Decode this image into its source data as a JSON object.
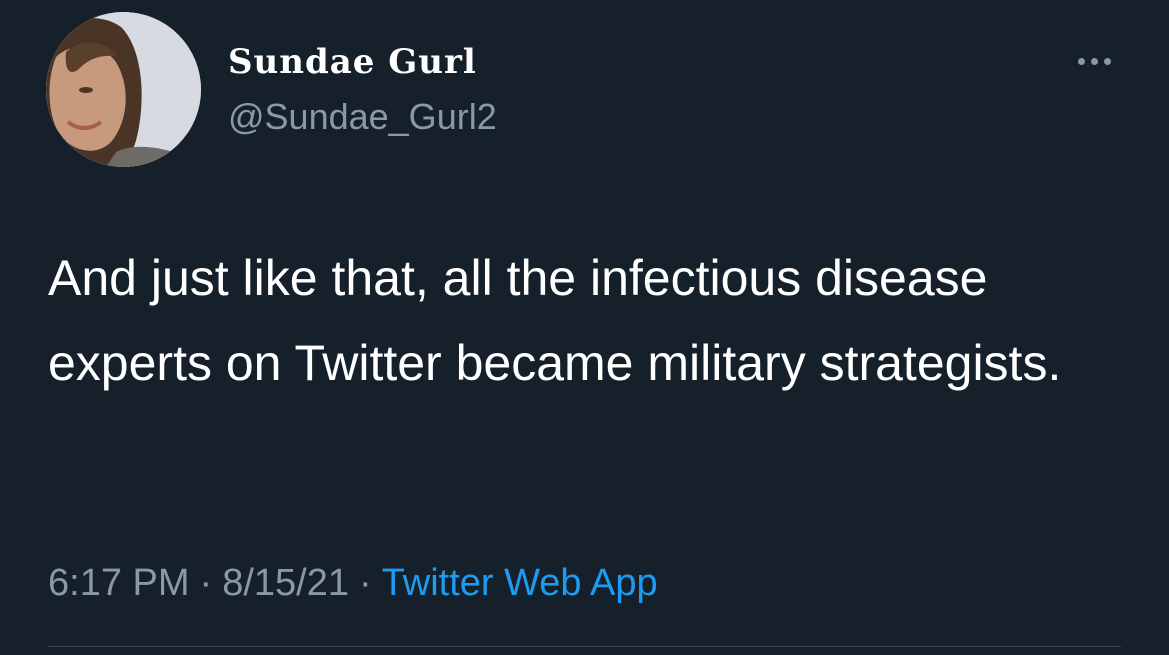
{
  "tweet": {
    "author": {
      "display_name": "Sundae Gurl",
      "handle": "@Sundae_Gurl2"
    },
    "text": "And just like that, all the infectious disease experts on Twitter became military strategists.",
    "timestamp": {
      "time": "6:17 PM",
      "separator": "·",
      "date": "8/15/21",
      "source": "Twitter Web App"
    }
  },
  "icons": {
    "more": "more-options-icon"
  },
  "colors": {
    "background": "#15202b",
    "primary_text": "#ffffff",
    "secondary_text": "#8b98a5",
    "link": "#1d9bf0",
    "divider": "#38444d"
  }
}
